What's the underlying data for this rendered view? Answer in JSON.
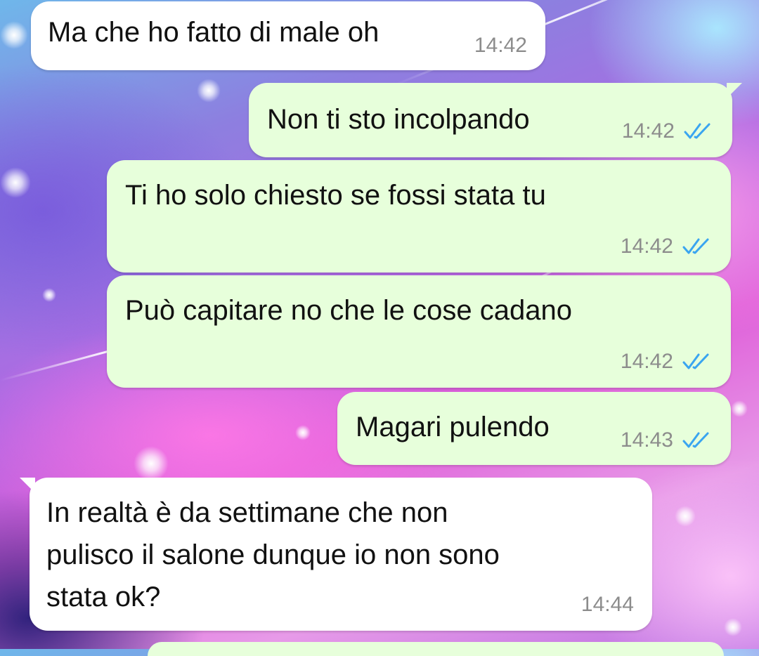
{
  "theme": {
    "incoming_bubble": "#ffffff",
    "outgoing_bubble": "#e7ffdb",
    "read_receipt": "#3aa5f0",
    "timestamp": "#8c8c8c"
  },
  "messages": [
    {
      "direction": "incoming",
      "text": "Ma che ho fatto di male oh",
      "time": "14:42"
    },
    {
      "direction": "outgoing",
      "text": "Non ti sto incolpando",
      "time": "14:42",
      "status": "read-double-check-icon"
    },
    {
      "direction": "outgoing",
      "text": "Ti ho solo chiesto se fossi stata tu",
      "time": "14:42",
      "status": "read-double-check-icon"
    },
    {
      "direction": "outgoing",
      "text": "Può capitare no che le cose cadano",
      "time": "14:42",
      "status": "read-double-check-icon"
    },
    {
      "direction": "outgoing",
      "text": "Magari pulendo",
      "time": "14:43",
      "status": "read-double-check-icon"
    },
    {
      "direction": "incoming",
      "text": "In realtà è da settimane che non\npulisco il salone dunque io non sono\nstata ok?",
      "time": "14:44"
    }
  ]
}
